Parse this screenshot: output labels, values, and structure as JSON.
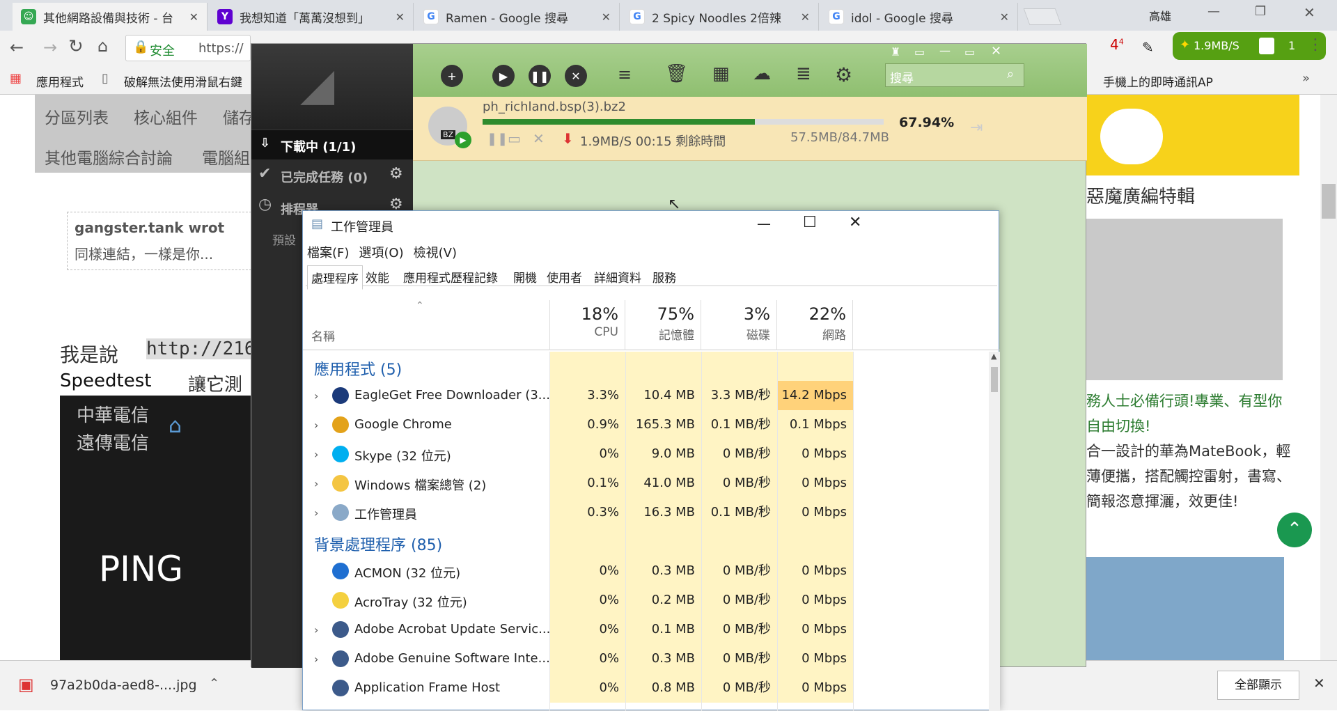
{
  "browser": {
    "tabs": [
      {
        "title": "其他網路設備與技術 - 台",
        "icon": "forum-icon",
        "color": "#35a853"
      },
      {
        "title": "我想知道「萬萬沒想到」",
        "icon": "yahoo-icon",
        "color": "#5f01d1"
      },
      {
        "title": "Ramen - Google 搜尋",
        "icon": "google-icon",
        "color": "#4285f4"
      },
      {
        "title": "2 Spicy Noodles 2倍辣",
        "icon": "google-icon",
        "color": "#4285f4"
      },
      {
        "title": "idol - Google 搜尋",
        "icon": "google-icon",
        "color": "#4285f4"
      }
    ],
    "user_label": "高雄",
    "security_label": "安全",
    "url": "https://",
    "bookmarks": [
      "應用程式",
      "破解無法使用滑鼠右鍵",
      "手機上的即時通訊AP"
    ],
    "speed_badge": "1.9MB/S",
    "task_count": "1",
    "ext_badge": "4"
  },
  "page": {
    "nav_tabs": [
      "分區列表",
      "核心組件",
      "儲存",
      "其他電腦綜合討論",
      "電腦組"
    ],
    "quote_author": "gangster.tank wrot",
    "quote_text": "同樣連結，一樣是你...",
    "post_text": "我是說",
    "post_link": "http://216",
    "post_text2": "Speedtest",
    "post_text3": "讓它測",
    "speedtest_isp1": "中華電信",
    "speedtest_isp2": "遠傳電信",
    "speedtest_ping": "PING",
    "sidebar_heading": "惡魔廣編特輯",
    "ad_title": "務人士必備行頭!專業、有型你自由切換!",
    "ad_body": "合一設計的華為MateBook，輕薄便攜，搭配觸控雷射，書寫、簡報恣意揮灑，效更佳!"
  },
  "download_shelf": {
    "file": "97a2b0da-aed8-....jpg",
    "show_all": "全部顯示"
  },
  "eagleget": {
    "sidebar": [
      {
        "label": "下載中 (1/1)",
        "icon": "download-icon"
      },
      {
        "label": "已完成任務 (0)",
        "icon": "check-circle-icon"
      },
      {
        "label": "排程器",
        "icon": "clock-icon"
      }
    ],
    "preset_label": "預設",
    "search_placeholder": "搜尋",
    "task": {
      "filename": "ph_richland.bsp(3).bz2",
      "percent": "67.94%",
      "progress": 0.6794,
      "speed": "1.9MB/S 00:15 剩餘時間",
      "size": "57.5MB/84.7MB",
      "type_badge": "BZ"
    }
  },
  "taskmgr": {
    "title": "工作管理員",
    "menu": [
      "檔案(F)",
      "選項(O)",
      "檢視(V)"
    ],
    "tabs": [
      "處理程序",
      "效能",
      "應用程式歷程記錄",
      "開機",
      "使用者",
      "詳細資料",
      "服務"
    ],
    "columns": {
      "name": "名稱",
      "cpu_pct": "18%",
      "cpu": "CPU",
      "mem_pct": "75%",
      "mem": "記憶體",
      "disk_pct": "3%",
      "disk": "磁碟",
      "net_pct": "22%",
      "net": "網路"
    },
    "groups": {
      "apps": "應用程式 (5)",
      "background": "背景處理程序 (85)"
    },
    "apps": [
      {
        "name": "EagleGet Free Downloader (3...",
        "cpu": "3.3%",
        "mem": "10.4 MB",
        "disk": "3.3 MB/秒",
        "net": "14.2 Mbps",
        "icon": "eagle-icon",
        "color": "#1b3a7a"
      },
      {
        "name": "Google Chrome",
        "cpu": "0.9%",
        "mem": "165.3 MB",
        "disk": "0.1 MB/秒",
        "net": "0.1 Mbps",
        "icon": "chrome-icon",
        "color": "#e3a21a"
      },
      {
        "name": "Skype (32 位元)",
        "cpu": "0%",
        "mem": "9.0 MB",
        "disk": "0 MB/秒",
        "net": "0 Mbps",
        "icon": "skype-icon",
        "color": "#00aff0"
      },
      {
        "name": "Windows 檔案總管 (2)",
        "cpu": "0.1%",
        "mem": "41.0 MB",
        "disk": "0 MB/秒",
        "net": "0 Mbps",
        "icon": "folder-icon",
        "color": "#f4c542"
      },
      {
        "name": "工作管理員",
        "cpu": "0.3%",
        "mem": "16.3 MB",
        "disk": "0.1 MB/秒",
        "net": "0 Mbps",
        "icon": "taskmgr-icon",
        "color": "#8aa9c8"
      }
    ],
    "background": [
      {
        "name": "ACMON (32 位元)",
        "cpu": "0%",
        "mem": "0.3 MB",
        "disk": "0 MB/秒",
        "net": "0 Mbps",
        "icon": "acmon-icon",
        "color": "#1f6fd1",
        "expand": false
      },
      {
        "name": "AcroTray (32 位元)",
        "cpu": "0%",
        "mem": "0.2 MB",
        "disk": "0 MB/秒",
        "net": "0 Mbps",
        "icon": "acrotray-icon",
        "color": "#f4d03f",
        "expand": false
      },
      {
        "name": "Adobe Acrobat Update Servic...",
        "cpu": "0%",
        "mem": "0.1 MB",
        "disk": "0 MB/秒",
        "net": "0 Mbps",
        "icon": "window-icon",
        "color": "#3c5a8a",
        "expand": true
      },
      {
        "name": "Adobe Genuine Software Inte...",
        "cpu": "0%",
        "mem": "0.3 MB",
        "disk": "0 MB/秒",
        "net": "0 Mbps",
        "icon": "window-icon",
        "color": "#3c5a8a",
        "expand": true
      },
      {
        "name": "Application Frame Host",
        "cpu": "0%",
        "mem": "0.8 MB",
        "disk": "0 MB/秒",
        "net": "0 Mbps",
        "icon": "window-icon",
        "color": "#3c5a8a",
        "expand": false
      }
    ]
  }
}
